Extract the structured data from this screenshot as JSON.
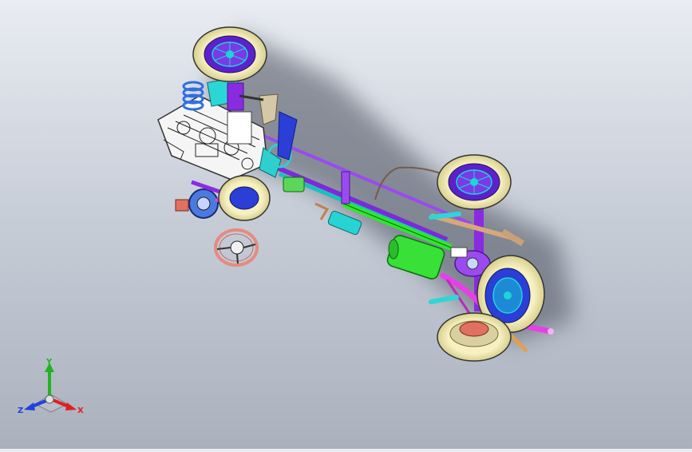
{
  "viewport": {
    "background_top": "#e9ecf2",
    "background_bottom": "#aab1bd"
  },
  "colors": {
    "tire": "#f4eeb8",
    "rim": "#6a2bd6",
    "rim_accent": "#22d6d6",
    "frame": "#8a2be2",
    "driveshaft": "#2ee82e",
    "muffler": "#35e035",
    "exhaust": "#e83ee8",
    "spring": "#2f6fe0",
    "steering_wheel": "#e58b80",
    "engine": "#ffffff",
    "shadow": "#5b6270"
  },
  "triad": {
    "x_label": "X",
    "y_label": "Y",
    "z_label": "Z",
    "x_color": "#e02020",
    "y_color": "#1fb51f",
    "z_color": "#2040e0"
  }
}
